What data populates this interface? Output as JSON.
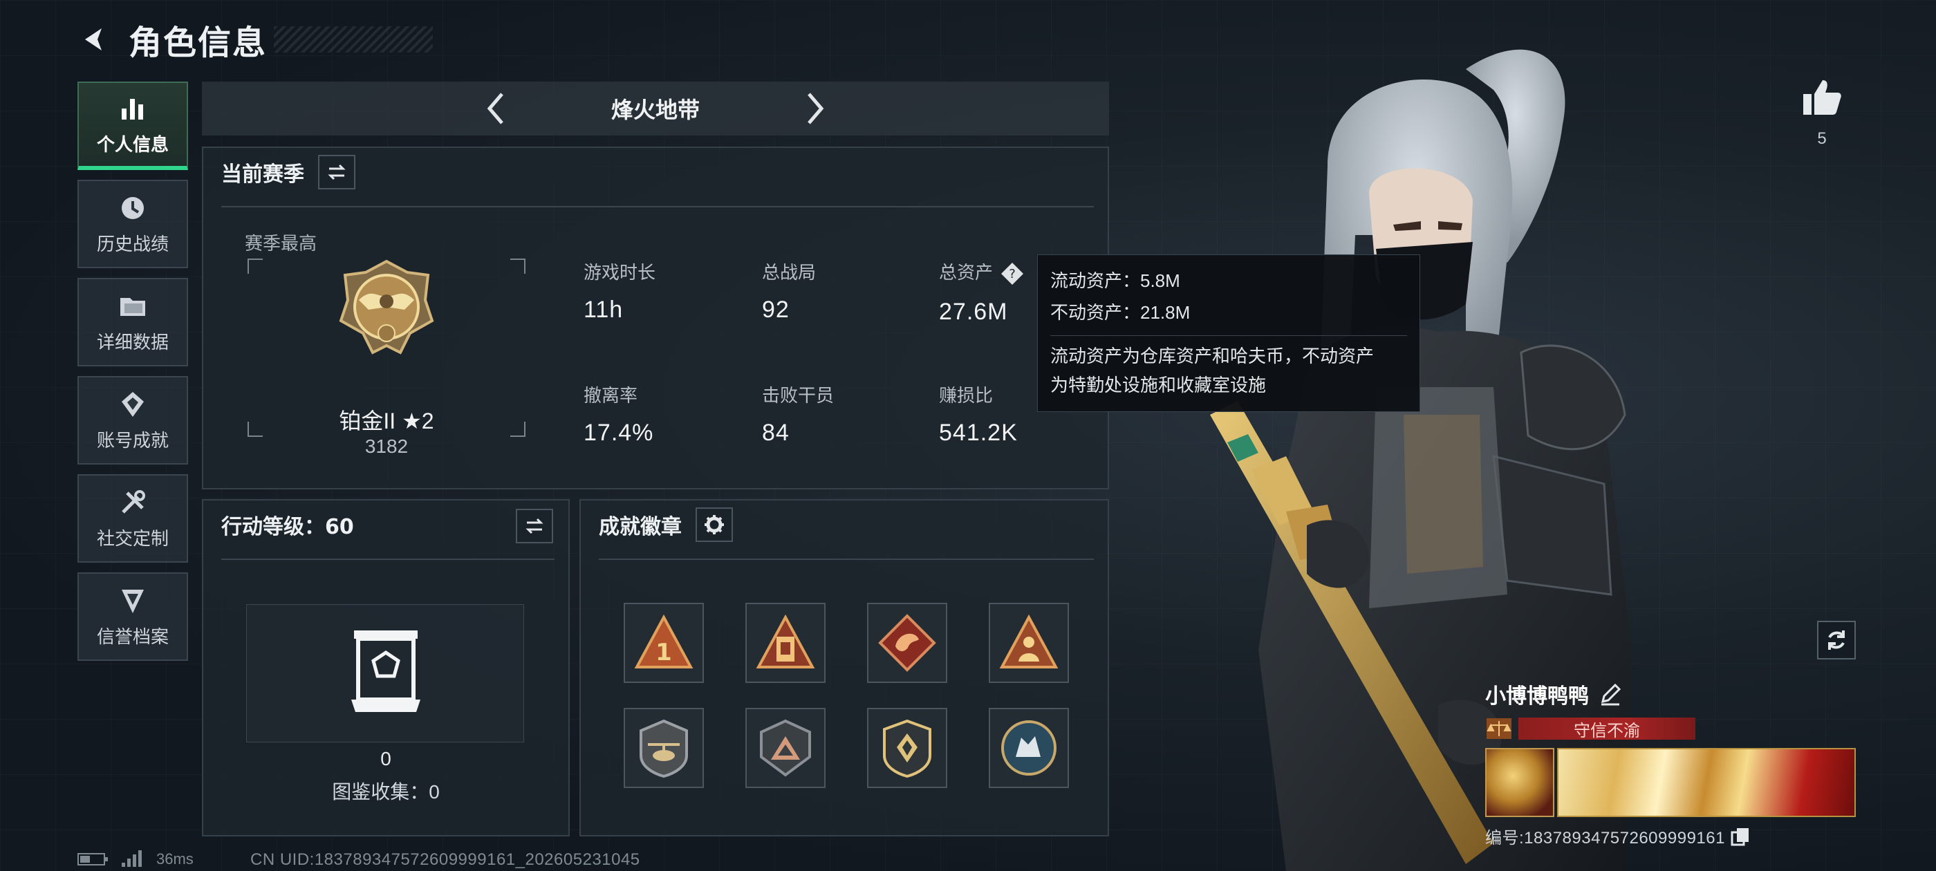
{
  "header": {
    "title": "角色信息"
  },
  "sidebar": {
    "items": [
      {
        "label": "个人信息",
        "icon": "bar-chart-icon",
        "active": true
      },
      {
        "label": "历史战绩",
        "icon": "clock-icon",
        "active": false
      },
      {
        "label": "详细数据",
        "icon": "folder-icon",
        "active": false
      },
      {
        "label": "账号成就",
        "icon": "achievement-icon",
        "active": false
      },
      {
        "label": "社交定制",
        "icon": "tools-icon",
        "active": false
      },
      {
        "label": "信誉档案",
        "icon": "shield-icon",
        "active": false
      }
    ]
  },
  "mode": {
    "title": "烽火地带"
  },
  "season": {
    "title": "当前赛季",
    "best_label": "赛季最高",
    "rank_name": "铂金II ★2",
    "rank_score": "3182",
    "stats": [
      {
        "label": "游戏时长",
        "value": "11h"
      },
      {
        "label": "总战局",
        "value": "92"
      },
      {
        "label": "总资产",
        "value": "27.6M"
      },
      {
        "label": "撤离率",
        "value": "17.4%"
      },
      {
        "label": "击败干员",
        "value": "84"
      },
      {
        "label": "赚损比",
        "value": "541.2K"
      }
    ]
  },
  "tooltip": {
    "liquid": "流动资产：5.8M",
    "fixed": "不动资产：21.8M",
    "desc_line1": "流动资产为仓库资产和哈夫币，不动资产",
    "desc_line2": "为特勤处设施和收藏室设施"
  },
  "level": {
    "title": "行动等级：60",
    "collect_count": "0",
    "collect_label": "图鉴收集：0"
  },
  "achievements": {
    "title": "成就徽章",
    "badges": [
      "rank-one-badge",
      "tower-badge",
      "dragon-badge",
      "soldier-badge",
      "helicopter-badge",
      "mountain-badge",
      "tactical-badge",
      "wolf-badge"
    ]
  },
  "player": {
    "likes": "5",
    "name": "小博博鸭鸭",
    "honor_title": "守信不渝",
    "serial": "编号:1837893475726099991​61"
  },
  "status": {
    "ping": "36ms",
    "uid": "CN UID:1837893475726099991​61_202605231045"
  },
  "colors": {
    "accent_green": "#2fd58a",
    "title_red": "#a82424",
    "gold": "#c09a50"
  }
}
